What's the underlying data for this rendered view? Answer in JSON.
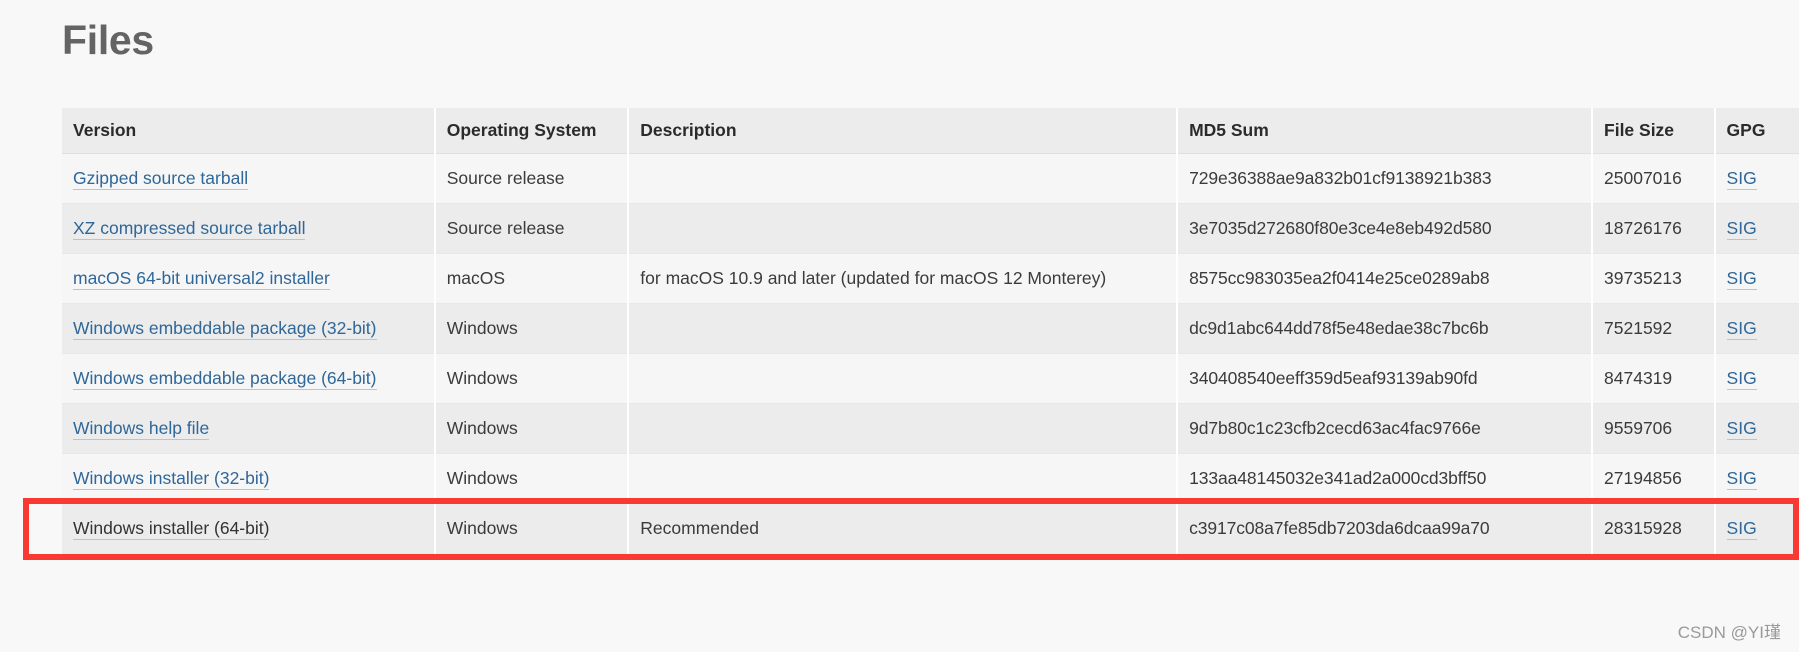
{
  "page": {
    "title": "Files",
    "watermark": "CSDN @YI瑾"
  },
  "table": {
    "columns": [
      {
        "key": "version",
        "label": "Version"
      },
      {
        "key": "os",
        "label": "Operating System"
      },
      {
        "key": "description",
        "label": "Description"
      },
      {
        "key": "md5",
        "label": "MD5 Sum"
      },
      {
        "key": "size",
        "label": "File Size"
      },
      {
        "key": "gpg",
        "label": "GPG"
      }
    ],
    "rows": [
      {
        "version": "Gzipped source tarball",
        "os": "Source release",
        "description": "",
        "md5": "729e36388ae9a832b01cf9138921b383",
        "size": "25007016",
        "gpg": "SIG",
        "visited": false
      },
      {
        "version": "XZ compressed source tarball",
        "os": "Source release",
        "description": "",
        "md5": "3e7035d272680f80e3ce4e8eb492d580",
        "size": "18726176",
        "gpg": "SIG",
        "visited": false
      },
      {
        "version": "macOS 64-bit universal2 installer",
        "os": "macOS",
        "description": "for macOS 10.9 and later (updated for macOS 12 Monterey)",
        "md5": "8575cc983035ea2f0414e25ce0289ab8",
        "size": "39735213",
        "gpg": "SIG",
        "visited": false
      },
      {
        "version": "Windows embeddable package (32-bit)",
        "os": "Windows",
        "description": "",
        "md5": "dc9d1abc644dd78f5e48edae38c7bc6b",
        "size": "7521592",
        "gpg": "SIG",
        "visited": false
      },
      {
        "version": "Windows embeddable package (64-bit)",
        "os": "Windows",
        "description": "",
        "md5": "340408540eeff359d5eaf93139ab90fd",
        "size": "8474319",
        "gpg": "SIG",
        "visited": false
      },
      {
        "version": "Windows help file",
        "os": "Windows",
        "description": "",
        "md5": "9d7b80c1c23cfb2cecd63ac4fac9766e",
        "size": "9559706",
        "gpg": "SIG",
        "visited": false
      },
      {
        "version": "Windows installer (32-bit)",
        "os": "Windows",
        "description": "",
        "md5": "133aa48145032e341ad2a000cd3bff50",
        "size": "27194856",
        "gpg": "SIG",
        "visited": false
      },
      {
        "version": "Windows installer (64-bit)",
        "os": "Windows",
        "description": "Recommended",
        "md5": "c3917c08a7fe85db7203da6dcaa99a70",
        "size": "28315928",
        "gpg": "SIG",
        "visited": true
      }
    ]
  },
  "annotation": {
    "highlight_color": "#f93a33",
    "highlighted_row_index": 7
  }
}
